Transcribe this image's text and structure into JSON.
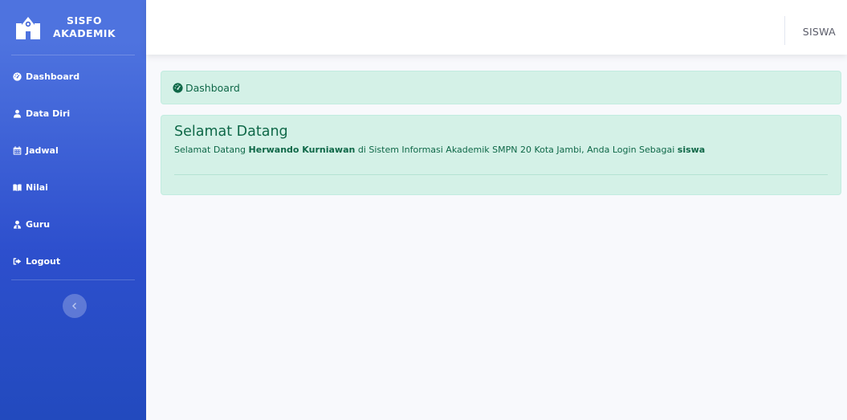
{
  "brand": {
    "line1": "SISFO",
    "line2": "AKADEMIK"
  },
  "sidebar": {
    "items": [
      {
        "label": "Dashboard",
        "icon": "tachometer-icon"
      },
      {
        "label": "Data Diri",
        "icon": "user-icon"
      },
      {
        "label": "Jadwal",
        "icon": "calendar-icon"
      },
      {
        "label": "Nilai",
        "icon": "book-icon"
      },
      {
        "label": "Guru",
        "icon": "user-tie-icon"
      },
      {
        "label": "Logout",
        "icon": "sign-out-icon"
      }
    ],
    "toggle_icon": "chevron-left-icon"
  },
  "topbar": {
    "user": "SISWA"
  },
  "breadcrumb": {
    "label": "Dashboard",
    "icon": "tachometer-icon"
  },
  "welcome": {
    "title": "Selamat Datang",
    "text_prefix": "Selamat Datang ",
    "name": "Herwando Kurniawan",
    "text_middle": " di Sistem Informasi Akademik SMPN 20 Kota Jambi, Anda Login Sebagai ",
    "role": "siswa"
  },
  "colors": {
    "sidebar_gradient_top": "#4e73df",
    "sidebar_gradient_bottom": "#224abe",
    "alert_bg": "#d4f1e7",
    "alert_text": "#0f6848"
  }
}
